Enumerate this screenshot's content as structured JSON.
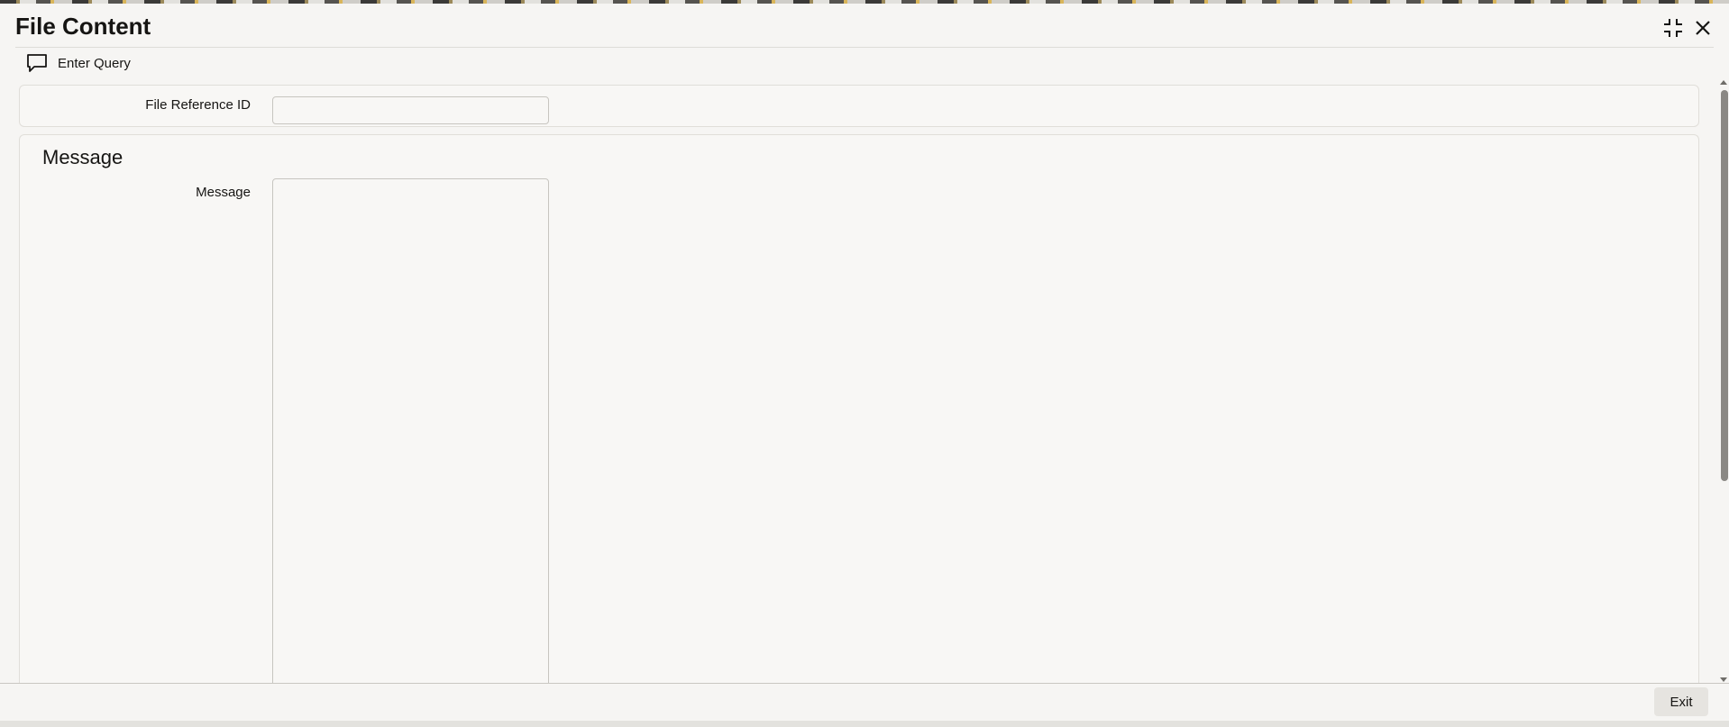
{
  "window": {
    "title": "File Content",
    "icons": {
      "minimize": "collapse-icon",
      "close": "close-icon"
    }
  },
  "toolbar": {
    "enter_query_label": "Enter Query",
    "enter_query_icon": "chat-bubble-icon"
  },
  "fields": {
    "file_reference_id": {
      "label": "File Reference ID",
      "value": ""
    }
  },
  "message_section": {
    "title": "Message",
    "message_label": "Message",
    "message_value": ""
  },
  "footer": {
    "exit_label": "Exit"
  }
}
